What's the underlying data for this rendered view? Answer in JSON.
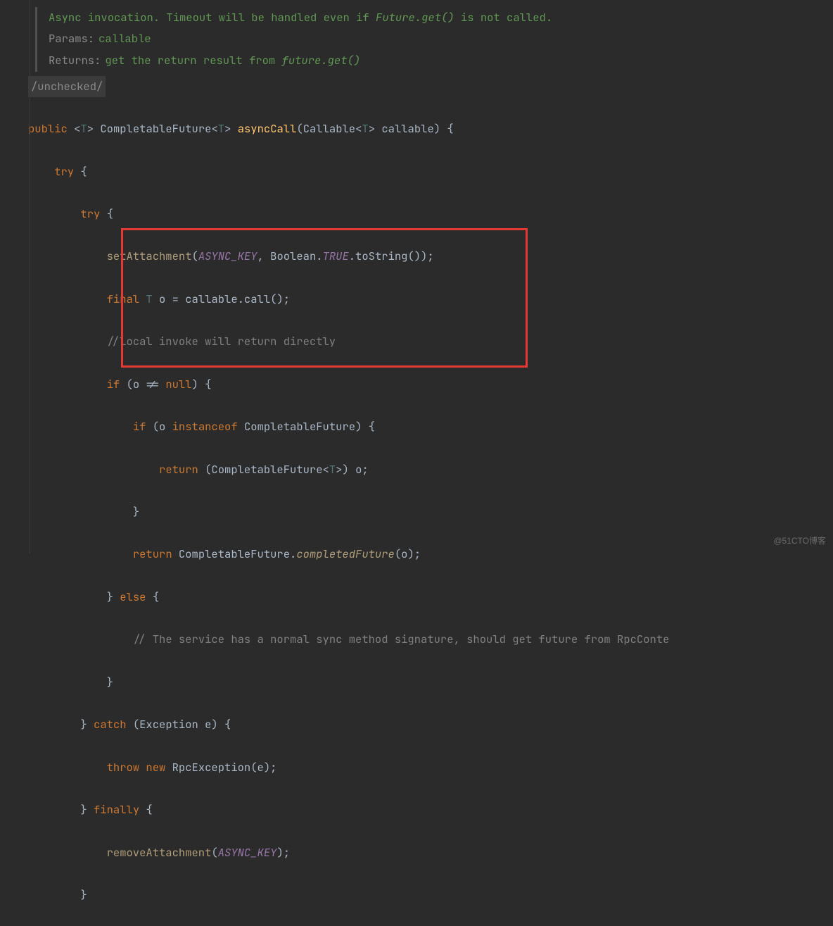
{
  "doc": {
    "desc_pre": "Async invocation. Timeout will be handled even if ",
    "desc_code": "Future.get()",
    "desc_post": " is not called.",
    "params_label": "Params:",
    "params_value": "callable",
    "returns_label": "Returns:",
    "returns_pre": "get the return result from ",
    "returns_code": "future.get()"
  },
  "annotation": "/unchecked/",
  "code": {
    "l1_public": "public ",
    "l1_generic_open": "<",
    "l1_generic_T": "T",
    "l1_generic_close": "> ",
    "l1_ret_type": "CompletableFuture",
    "l1_ret_gen_open": "<",
    "l1_ret_T": "T",
    "l1_ret_gen_close": "> ",
    "l1_method": "asyncCall",
    "l1_params_open": "(",
    "l1_param_type": "Callable",
    "l1_param_gen_open": "<",
    "l1_param_T": "T",
    "l1_param_gen_close": "> ",
    "l1_param_name": "callable",
    "l1_params_close": ") {",
    "l2_try": "try ",
    "l2_brace": "{",
    "l3_try": "try ",
    "l3_brace": "{",
    "l4_pre": "            ",
    "l4_call": "setAttachment",
    "l4_open": "(",
    "l4_const": "ASYNC_KEY",
    "l4_sep": ", ",
    "l4_bool": "Boolean.",
    "l4_true": "TRUE",
    "l4_tostr": ".toString());",
    "l5_pre": "            ",
    "l5_final": "final ",
    "l5_T": "T ",
    "l5_rest": "o = callable.call();",
    "l6_pre": "            ",
    "l6_comment": "//local invoke will return directly",
    "l7_pre": "            ",
    "l7_if": "if ",
    "l7_cond": "(o != ",
    "l7_null": "null",
    "l7_close": ") {",
    "l8_pre": "                ",
    "l8_if": "if ",
    "l8_open": "(o ",
    "l8_instanceof": "instanceof ",
    "l8_type": "CompletableFuture) {",
    "l9_pre": "                    ",
    "l9_return": "return ",
    "l9_cast_open": "(CompletableFuture",
    "l9_gen_open": "<",
    "l9_T": "T",
    "l9_gen_close": ">",
    "l9_cast_close": ") o;",
    "l10_pre": "                ",
    "l10_brace": "}",
    "l11_pre": "                ",
    "l11_return": "return ",
    "l11_type": "CompletableFuture.",
    "l11_static": "completedFuture",
    "l11_args": "(o);",
    "l12_pre": "            ",
    "l12_brace": "} ",
    "l12_else": "else ",
    "l12_open": "{",
    "l13_pre": "                ",
    "l13_comment": "// The service has a normal sync method signature, should get future from RpcConte",
    "l14_pre": "            ",
    "l14_brace": "}",
    "l15_pre": "        ",
    "l15_brace": "} ",
    "l15_catch": "catch ",
    "l15_open": "(Exception e) {",
    "l16_pre": "            ",
    "l16_throw": "throw new ",
    "l16_type": "RpcException(e);",
    "l17_pre": "        ",
    "l17_brace": "} ",
    "l17_finally": "finally ",
    "l17_open": "{",
    "l18_pre": "            ",
    "l18_call": "removeAttachment",
    "l18_open": "(",
    "l18_const": "ASYNC_KEY",
    "l18_close": ");",
    "l19_pre": "        ",
    "l19_brace": "}"
  },
  "watermark": "@51CTO博客"
}
